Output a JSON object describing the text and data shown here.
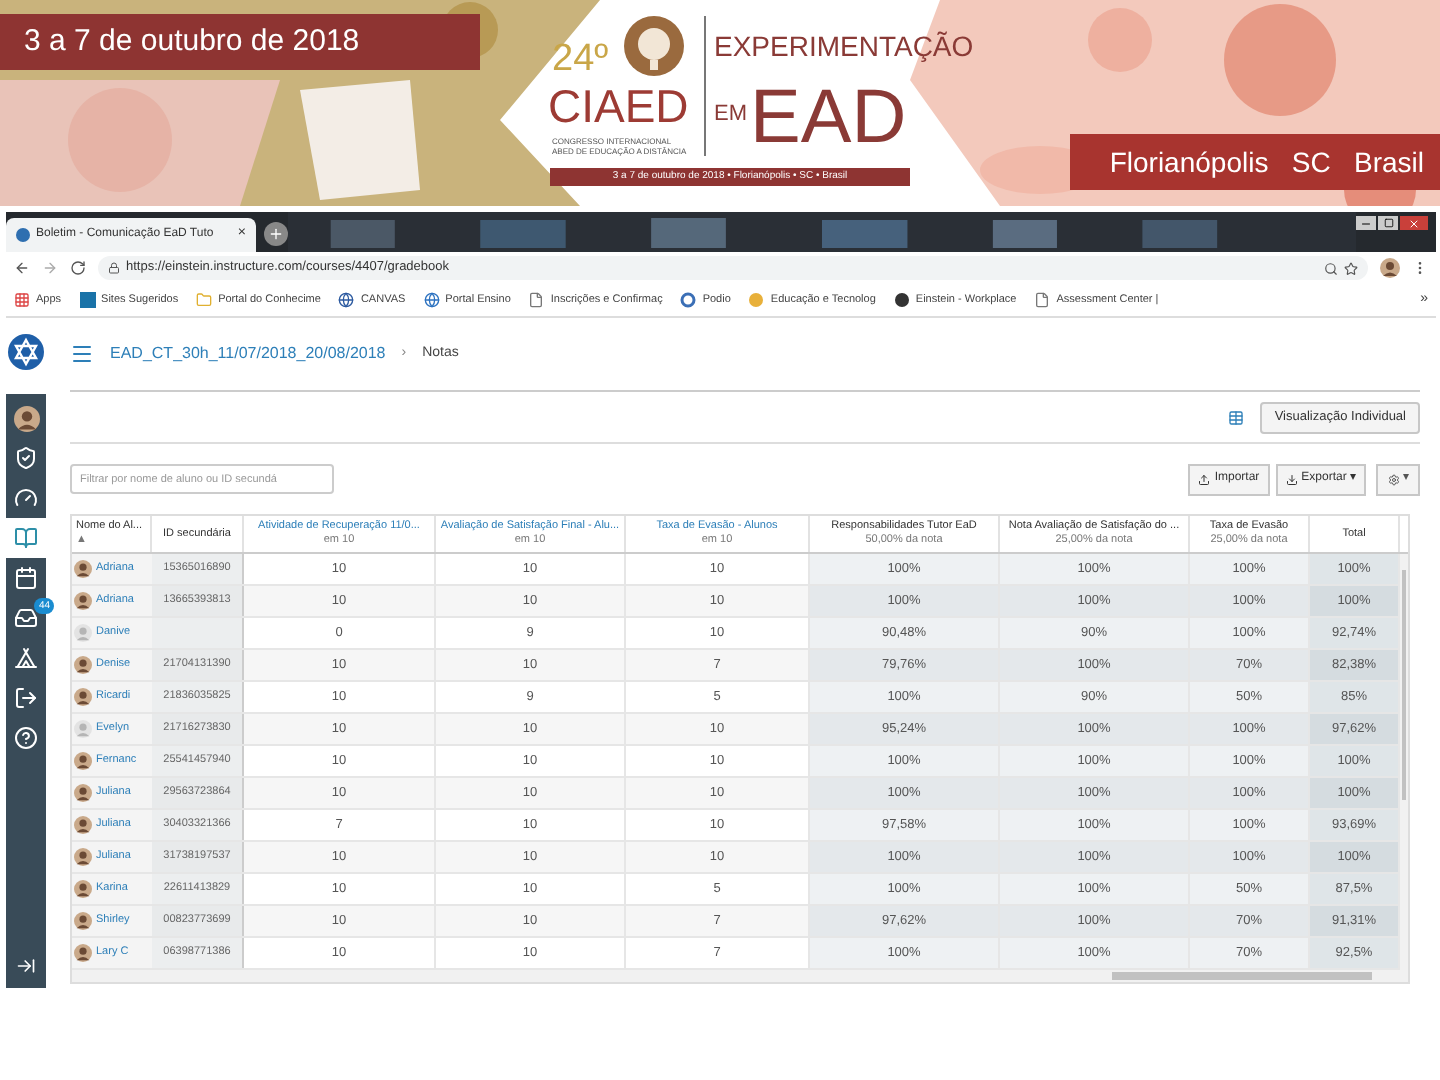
{
  "banner": {
    "date_band": "3 a 7 de outubro de 2018",
    "edition": "24º",
    "acronym": "CIAED",
    "subtitle": "CONGRESSO INTERNACIONAL ABED DE EDUCAÇÃO A DISTÂNCIA",
    "theme_line_1": "EXPERIMENTAÇÃO",
    "theme_em": "EM",
    "theme_ead": "EAD",
    "info_bar": "3 a 7 de outubro de 2018 • Florianópolis • SC • Brasil",
    "place_band": "Florianópolis   SC   Brasil"
  },
  "browser": {
    "tab": {
      "title": "Boletim - Comunicação EaD Tuto",
      "close": "×"
    },
    "url": "https://einstein.instructure.com/courses/4407/gradebook",
    "bookmarks": [
      {
        "label": "Apps"
      },
      {
        "label": "Sites Sugeridos"
      },
      {
        "label": "Portal do Conhecime"
      },
      {
        "label": "CANVAS"
      },
      {
        "label": "Portal Ensino"
      },
      {
        "label": "Inscrições e Confirmaç"
      },
      {
        "label": "Podio"
      },
      {
        "label": "Educação e Tecnolog"
      },
      {
        "label": "Einstein - Workplace"
      },
      {
        "label": "Assessment Center |"
      }
    ],
    "bookmarks_more": "»"
  },
  "nav": [
    {
      "selected": false
    },
    {
      "selected": false
    },
    {
      "selected": false
    },
    {
      "selected": true
    },
    {
      "selected": false
    },
    {
      "selected": false,
      "badge": "44"
    },
    {
      "selected": false
    },
    {
      "selected": false
    },
    {
      "selected": false
    }
  ],
  "breadcrumb": {
    "course": "EAD_CT_30h_11/07/2018_20/08/2018",
    "separator": "›",
    "page": "Notas"
  },
  "view_button": "Visualização Individual",
  "filter": {
    "placeholder": "Filtrar por nome de aluno ou ID secundá"
  },
  "actions": {
    "import": "Importar",
    "export": "Exportar ▾",
    "settings_caret": "▾"
  },
  "table": {
    "columns": [
      {
        "kind": "student",
        "title": "Nome do Al...",
        "subtitle": "▲"
      },
      {
        "kind": "plain",
        "title": "ID secundária"
      },
      {
        "kind": "assignment",
        "title": "Atividade de Recuperação 11/0...",
        "subtitle": "em 10"
      },
      {
        "kind": "assignment",
        "title": "Avaliação de Satisfação Final - Alu...",
        "subtitle": "em 10"
      },
      {
        "kind": "assignment",
        "title": "Taxa de Evasão - Alunos",
        "subtitle": "em 10"
      },
      {
        "kind": "group",
        "title": "Responsabilidades Tutor EaD",
        "subtitle": "50,00% da nota"
      },
      {
        "kind": "group",
        "title": "Nota Avaliação de Satisfação do ...",
        "subtitle": "25,00% da nota"
      },
      {
        "kind": "group",
        "title": "Taxa de Evasão",
        "subtitle": "25,00% da nota"
      },
      {
        "kind": "total",
        "title": "Total"
      }
    ],
    "rows": [
      {
        "has_photo": true,
        "cells": [
          "Adriana",
          "15365016890",
          "10",
          "10",
          "10",
          "100%",
          "100%",
          "100%",
          "100%"
        ]
      },
      {
        "has_photo": true,
        "cells": [
          "Adriana",
          "13665393813",
          "10",
          "10",
          "10",
          "100%",
          "100%",
          "100%",
          "100%"
        ]
      },
      {
        "has_photo": false,
        "cells": [
          "Danive",
          "",
          "0",
          "9",
          "10",
          "90,48%",
          "90%",
          "100%",
          "92,74%"
        ]
      },
      {
        "has_photo": true,
        "cells": [
          "Denise",
          "21704131390",
          "10",
          "10",
          "7",
          "79,76%",
          "100%",
          "70%",
          "82,38%"
        ]
      },
      {
        "has_photo": true,
        "cells": [
          "Ricardi",
          "21836035825",
          "10",
          "9",
          "5",
          "100%",
          "90%",
          "50%",
          "85%"
        ]
      },
      {
        "has_photo": false,
        "cells": [
          "Evelyn",
          "21716273830",
          "10",
          "10",
          "10",
          "95,24%",
          "100%",
          "100%",
          "97,62%"
        ]
      },
      {
        "has_photo": true,
        "cells": [
          "Fernanc",
          "25541457940",
          "10",
          "10",
          "10",
          "100%",
          "100%",
          "100%",
          "100%"
        ]
      },
      {
        "has_photo": true,
        "cells": [
          "Juliana",
          "29563723864",
          "10",
          "10",
          "10",
          "100%",
          "100%",
          "100%",
          "100%"
        ]
      },
      {
        "has_photo": true,
        "cells": [
          "Juliana",
          "30403321366",
          "7",
          "10",
          "10",
          "97,58%",
          "100%",
          "100%",
          "93,69%"
        ]
      },
      {
        "has_photo": true,
        "cells": [
          "Juliana",
          "31738197537",
          "10",
          "10",
          "10",
          "100%",
          "100%",
          "100%",
          "100%"
        ]
      },
      {
        "has_photo": true,
        "cells": [
          "Karina",
          "22611413829",
          "10",
          "10",
          "5",
          "100%",
          "100%",
          "50%",
          "87,5%"
        ]
      },
      {
        "has_photo": true,
        "cells": [
          "Shirley",
          "00823773699",
          "10",
          "10",
          "7",
          "97,62%",
          "100%",
          "70%",
          "91,31%"
        ]
      },
      {
        "has_photo": true,
        "cells": [
          "Lary C",
          "06398771386",
          "10",
          "10",
          "7",
          "100%",
          "100%",
          "70%",
          "92,5%"
        ]
      }
    ]
  }
}
